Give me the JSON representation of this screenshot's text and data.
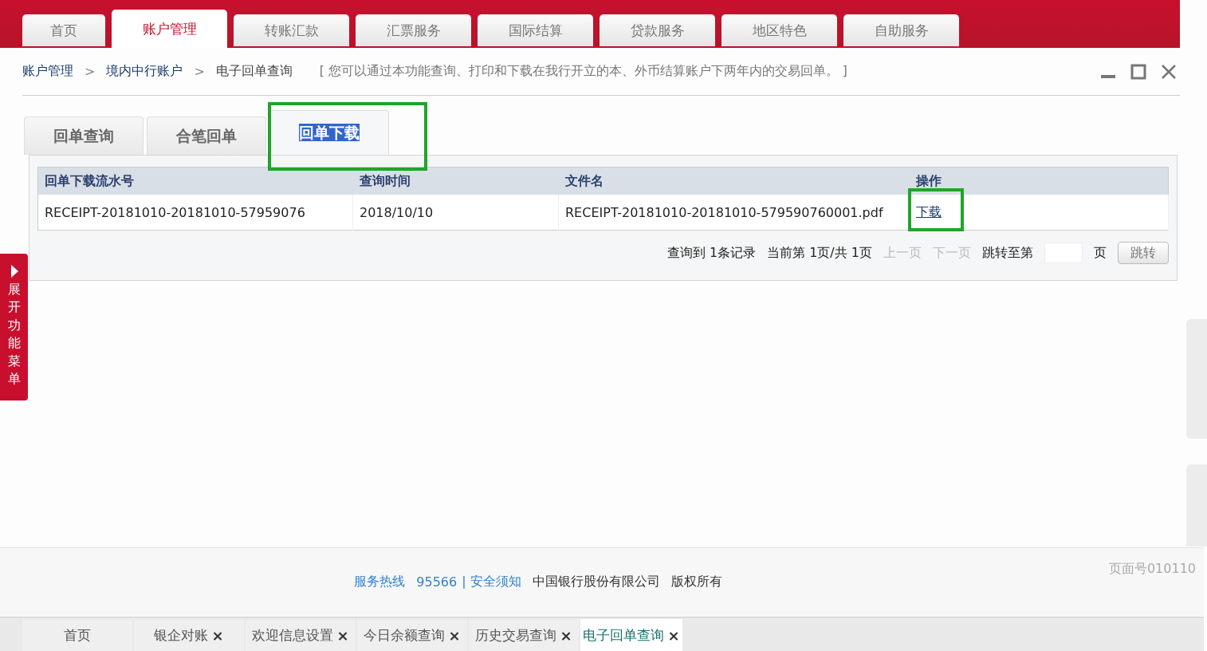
{
  "nav_tabs": [
    {
      "label": "首页",
      "selected": false
    },
    {
      "label": "账户管理",
      "selected": true
    },
    {
      "label": "转账汇款",
      "selected": false
    },
    {
      "label": "汇票服务",
      "selected": false
    },
    {
      "label": "国际结算",
      "selected": false
    },
    {
      "label": "贷款服务",
      "selected": false
    },
    {
      "label": "地区特色",
      "selected": false
    },
    {
      "label": "自助服务",
      "selected": false
    }
  ],
  "breadcrumb": [
    {
      "label": "账户管理",
      "kind": "link"
    },
    {
      "label": ">",
      "kind": "separator"
    },
    {
      "label": "境内中行账户",
      "kind": "link"
    },
    {
      "label": ">",
      "kind": "separator"
    },
    {
      "label": "电子回单查询",
      "kind": "current"
    }
  ],
  "description": "[ 您可以通过本功能查询、打印和下载在我行开立的本、外币结算账户下两年内的交易回单。 ]",
  "sub_tabs": [
    {
      "label": "回单查询",
      "selected": false,
      "highlighted": false
    },
    {
      "label": "合笔回单",
      "selected": false,
      "highlighted": false
    },
    {
      "label": "回单下载",
      "selected": true,
      "highlighted": true
    }
  ],
  "table": {
    "columns": [
      "回单下载流水号",
      "查询时间",
      "文件名",
      "操作"
    ],
    "rows": [
      {
        "serial": "RECEIPT-20181010-20181010-57959076",
        "time": "2018/10/10",
        "file": "RECEIPT-20181010-20181010-579590760001.pdf",
        "action": "下载",
        "action_highlighted": true
      }
    ]
  },
  "pagination": {
    "records": "查询到 1条记录",
    "current": "当前第 1页/共 1页",
    "prev": "上一页",
    "next": "下一页",
    "prev_disabled": true,
    "next_disabled": true,
    "goto_label": "跳转至第",
    "goto_unit": "页",
    "goto_button": "跳转"
  },
  "side_menu": {
    "label": "展开功能菜单"
  },
  "footer": {
    "hotline_label": "服务热线",
    "hotline": "95566",
    "notice": "| 安全须知",
    "company": "中国银行股份有限公司",
    "rights": "版权所有",
    "page_number": "页面号010110"
  },
  "bottom_tabs": [
    {
      "label": "首页",
      "selected": false,
      "closable": false
    },
    {
      "label": "银企对账",
      "selected": false,
      "closable": true
    },
    {
      "label": "欢迎信息设置",
      "selected": false,
      "closable": true
    },
    {
      "label": "今日余额查询",
      "selected": false,
      "closable": true
    },
    {
      "label": "历史交易查询",
      "selected": false,
      "closable": true
    },
    {
      "label": "电子回单查询",
      "selected": true,
      "closable": true
    }
  ],
  "close_glyph": "×"
}
